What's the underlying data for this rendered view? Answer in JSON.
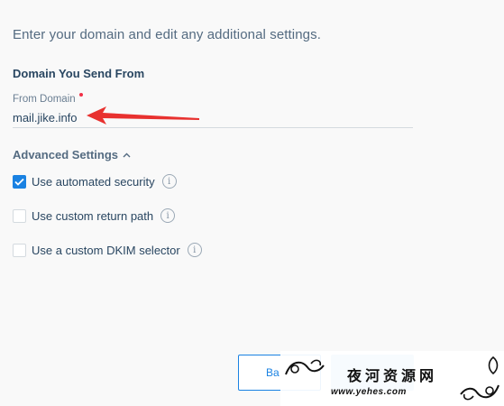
{
  "intro_text": "Enter your domain and edit any additional settings.",
  "domain_section": {
    "title": "Domain You Send From",
    "field_label": "From Domain",
    "field_value": "mail.jike.info"
  },
  "advanced": {
    "label": "Advanced Settings",
    "options": [
      {
        "label": "Use automated security",
        "checked": true
      },
      {
        "label": "Use custom return path",
        "checked": false
      },
      {
        "label": "Use a custom DKIM selector",
        "checked": false
      }
    ]
  },
  "buttons": {
    "back_label": "Ba",
    "next_label": ""
  },
  "watermark": {
    "title": "夜河资源网",
    "url": "www.yehes.com"
  },
  "colors": {
    "accent": "#1a82e2",
    "required": "#f22f46",
    "annotation_arrow": "#e8312f"
  },
  "icons": [
    "info-icon",
    "chevron-up-icon",
    "check-icon",
    "annotation-arrow"
  ]
}
